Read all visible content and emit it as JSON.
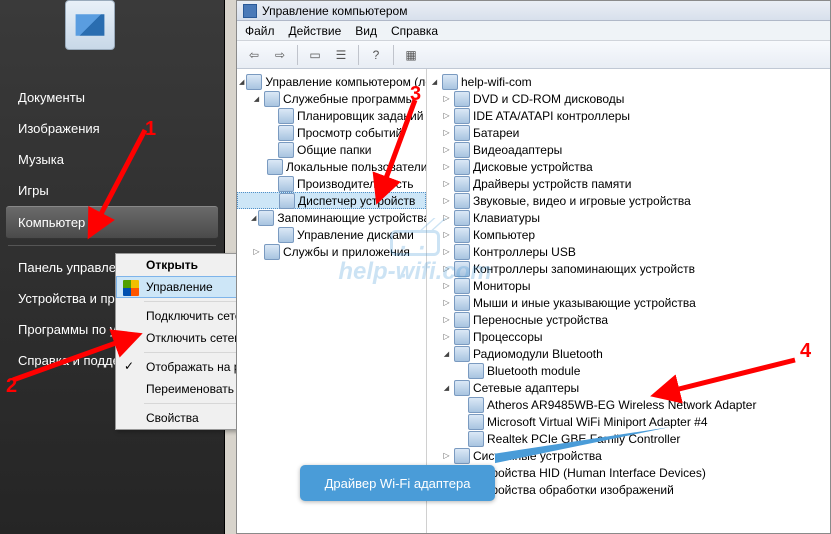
{
  "start_menu": {
    "items": [
      {
        "label": "Документы"
      },
      {
        "label": "Изображения"
      },
      {
        "label": "Музыка"
      },
      {
        "label": "Игры"
      },
      {
        "label": "Компьютер",
        "highlight": true
      },
      {
        "label": "Панель управления"
      },
      {
        "label": "Устройства и принтеры"
      },
      {
        "label": "Программы по умолчанию"
      },
      {
        "label": "Справка и поддержка"
      }
    ]
  },
  "context_menu": {
    "items": [
      {
        "label": "Открыть",
        "bold": true
      },
      {
        "label": "Управление",
        "icon": "shield",
        "highlight": true
      },
      {
        "sep": true
      },
      {
        "label": "Подключить сетевой диск..."
      },
      {
        "label": "Отключить сетевой диск..."
      },
      {
        "sep": true
      },
      {
        "label": "Отображать на рабочем столе",
        "icon": "check"
      },
      {
        "label": "Переименовать"
      },
      {
        "sep": true
      },
      {
        "label": "Свойства"
      }
    ]
  },
  "window": {
    "title": "Управление компьютером",
    "menus": [
      "Файл",
      "Действие",
      "Вид",
      "Справка"
    ]
  },
  "tree": {
    "root": "Управление компьютером (локальным)",
    "groups": [
      {
        "label": "Служебные программы",
        "open": true,
        "children": [
          {
            "label": "Планировщик заданий"
          },
          {
            "label": "Просмотр событий"
          },
          {
            "label": "Общие папки"
          },
          {
            "label": "Локальные пользователи"
          },
          {
            "label": "Производительность"
          },
          {
            "label": "Диспетчер устройств",
            "selected": true
          }
        ]
      },
      {
        "label": "Запоминающие устройства",
        "open": true,
        "children": [
          {
            "label": "Управление дисками"
          }
        ]
      },
      {
        "label": "Службы и приложения",
        "open": false
      }
    ]
  },
  "devices": {
    "root": "help-wifi-com",
    "categories": [
      {
        "label": "DVD и CD-ROM дисководы"
      },
      {
        "label": "IDE ATA/ATAPI контроллеры"
      },
      {
        "label": "Батареи"
      },
      {
        "label": "Видеоадаптеры"
      },
      {
        "label": "Дисковые устройства"
      },
      {
        "label": "Драйверы устройств памяти"
      },
      {
        "label": "Звуковые, видео и игровые устройства"
      },
      {
        "label": "Клавиатуры"
      },
      {
        "label": "Компьютер"
      },
      {
        "label": "Контроллеры USB"
      },
      {
        "label": "Контроллеры запоминающих устройств"
      },
      {
        "label": "Мониторы"
      },
      {
        "label": "Мыши и иные указывающие устройства"
      },
      {
        "label": "Переносные устройства"
      },
      {
        "label": "Процессоры"
      },
      {
        "label": "Радиомодули Bluetooth",
        "open": true,
        "children": [
          {
            "label": "Bluetooth module"
          }
        ]
      },
      {
        "label": "Сетевые адаптеры",
        "open": true,
        "children": [
          {
            "label": "Atheros AR9485WB-EG Wireless Network Adapter"
          },
          {
            "label": "Microsoft Virtual WiFi Miniport Adapter #4"
          },
          {
            "label": "Realtek PCIe GBE Family Controller"
          }
        ]
      },
      {
        "label": "Системные устройства"
      },
      {
        "label": "Устройства HID (Human Interface Devices)"
      },
      {
        "label": "Устройства обработки изображений"
      }
    ]
  },
  "annotations": {
    "num1": "1",
    "num2": "2",
    "num3": "3",
    "num4": "4",
    "callout": "Драйвер Wi-Fi адаптера",
    "watermark": "help-wifi.com"
  }
}
